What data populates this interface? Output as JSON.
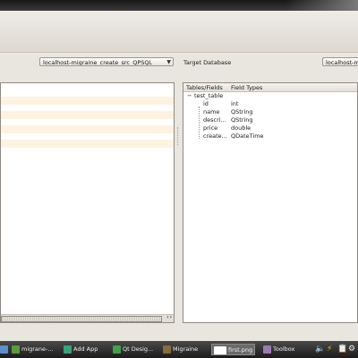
{
  "source": {
    "connection_value": "localhost-migraine_create_src_QPSQL"
  },
  "target": {
    "title": "Target Database",
    "connection_value": "localhost-migra",
    "columns": [
      "Tables/Fields",
      "Field Types"
    ],
    "table_name": "test_table",
    "expand_glyph": "−",
    "fields": [
      {
        "name": "id",
        "type": "int"
      },
      {
        "name": "name",
        "type": "QString"
      },
      {
        "name": "descri...",
        "type": "QString"
      },
      {
        "name": "price",
        "type": "double"
      },
      {
        "name": "create...",
        "type": "QDateTime"
      }
    ]
  },
  "taskbar": {
    "tasks": [
      {
        "label": "migrane-...",
        "icon": "migraine-app-icon"
      },
      {
        "label": "Add App",
        "icon": "wizard-icon"
      },
      {
        "label": "Qt Desig...",
        "icon": "qt-designer-icon"
      },
      {
        "label": "Migraine",
        "icon": "migraine-app-icon"
      },
      {
        "label": "first.png",
        "icon": "image-viewer-icon"
      },
      {
        "label": "Toolbox",
        "icon": "toolbox-icon"
      }
    ]
  },
  "colors": {
    "alt_row": "#fdf3e0",
    "taskbar": "#2b2b2b"
  }
}
